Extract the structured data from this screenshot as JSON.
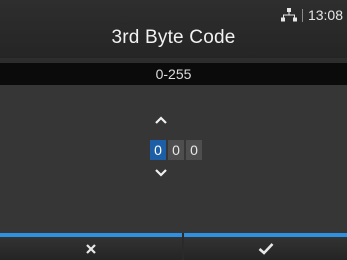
{
  "header": {
    "title": "3rd Byte Code",
    "time": "13:08",
    "network_icon": "network-icon"
  },
  "range": {
    "text": "0-255"
  },
  "spinner": {
    "digits": [
      "0",
      "0",
      "0"
    ],
    "active_index": 0,
    "up_icon": "chevron-up-icon",
    "down_icon": "chevron-down-icon"
  },
  "footer": {
    "cancel_icon": "close-icon",
    "confirm_icon": "check-icon"
  },
  "colors": {
    "accent": "#2f8fe0",
    "active_digit": "#1c5fa7",
    "background": "#363636"
  }
}
